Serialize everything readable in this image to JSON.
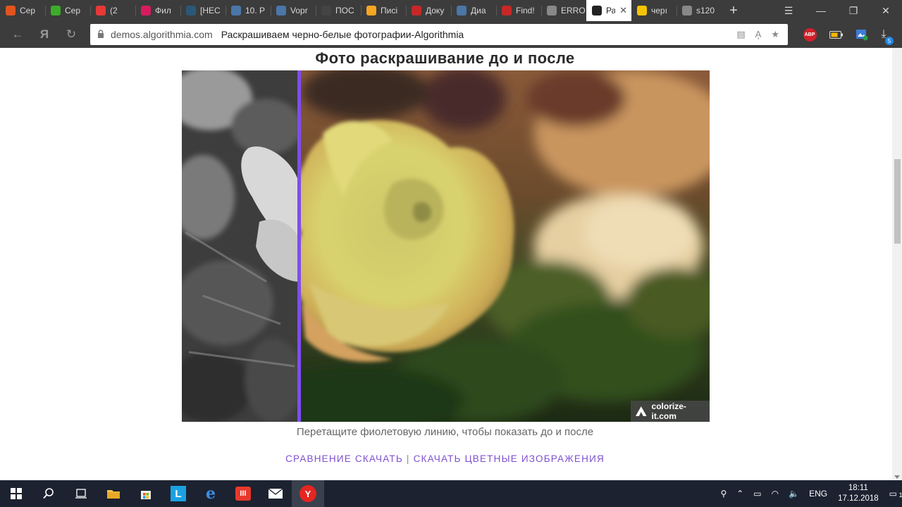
{
  "browser": {
    "tabs": [
      {
        "title": "Сер",
        "favicon_color": "#e2541f"
      },
      {
        "title": "Сер",
        "favicon_color": "#3cad2a"
      },
      {
        "title": "(2",
        "favicon_color": "#e53935"
      },
      {
        "title": "Фил",
        "favicon_color": "#d81b60"
      },
      {
        "title": "[НЕС",
        "favicon_color": "#2b5877"
      },
      {
        "title": "10. Р",
        "favicon_color": "#4a76a8"
      },
      {
        "title": "Vopr",
        "favicon_color": "#4a76a8"
      },
      {
        "title": "ПОС",
        "favicon_color": "#444444"
      },
      {
        "title": "Писі",
        "favicon_color": "#f5a623"
      },
      {
        "title": "Доку",
        "favicon_color": "#c62828"
      },
      {
        "title": "Диа",
        "favicon_color": "#4a76a8"
      },
      {
        "title": "Find!",
        "favicon_color": "#c62828"
      },
      {
        "title": "ERRO",
        "favicon_color": "#888888"
      },
      {
        "title": "Ра",
        "favicon_color": "#222222",
        "active": true,
        "close": "✕"
      },
      {
        "title": "черı",
        "favicon_color": "#f5c400"
      },
      {
        "title": "s120",
        "favicon_color": "#888888"
      }
    ],
    "new_tab": "+",
    "window": {
      "menu": "☰",
      "minimize": "—",
      "restore": "❐",
      "close": "✕"
    },
    "nav": {
      "back": "←",
      "yandex": "Я",
      "reload": "↻"
    },
    "address": {
      "domain": "demos.algorithmia.com",
      "title": "Раскрашиваем черно-белые фотографии-Algorithmia"
    },
    "extensions": {
      "abp": "ABP",
      "download_badge": "5"
    }
  },
  "page": {
    "heading": "Фото раскрашивание до и после",
    "watermark": "colorize-it.com",
    "caption": "Перетащите фиолетовую линию, чтобы показать до и после",
    "link_compare": "СРАВНЕНИЕ СКАЧАТЬ",
    "link_separator": "|",
    "link_color": "СКАЧАТЬ ЦВЕТНЫЕ ИЗОБРАЖЕНИЯ",
    "accent_color": "#7e4df0",
    "split_percent": 22
  },
  "taskbar": {
    "language": "ENG",
    "time": "18:11",
    "date": "17.12.2018",
    "notification_badge": "1"
  }
}
